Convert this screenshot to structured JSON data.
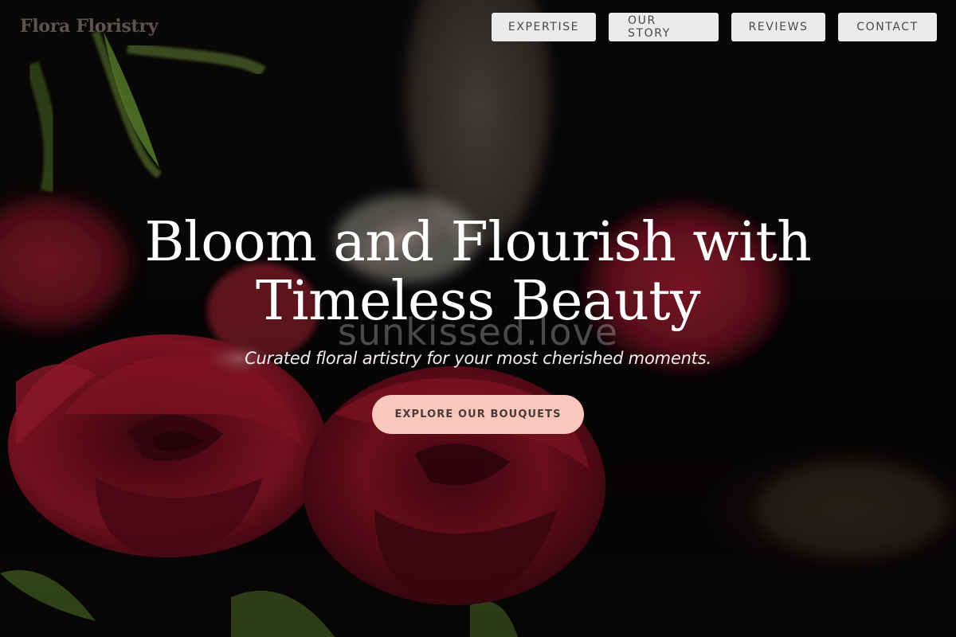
{
  "brand": {
    "logo_text": "Flora Floristry"
  },
  "nav": {
    "items": [
      {
        "label": "EXPERTISE"
      },
      {
        "label": "OUR STORY"
      },
      {
        "label": "REVIEWS"
      },
      {
        "label": "CONTACT"
      }
    ]
  },
  "hero": {
    "headline_line1": "Bloom and Flourish with",
    "headline_line2": "Timeless Beauty",
    "watermark": "sunkissed.love",
    "subtitle": "Curated floral artistry for your most cherished moments.",
    "cta_label": "EXPLORE OUR BOUQUETS",
    "background_subject": "red-roses-photo"
  },
  "colors": {
    "nav_button_bg": "#ebebeb",
    "nav_button_text": "#4a4a4a",
    "cta_bg": "#f9c7bb",
    "cta_text": "#4b3b37",
    "rose_red": "#7a0f1f",
    "leaf_green": "#4f6b2a"
  }
}
